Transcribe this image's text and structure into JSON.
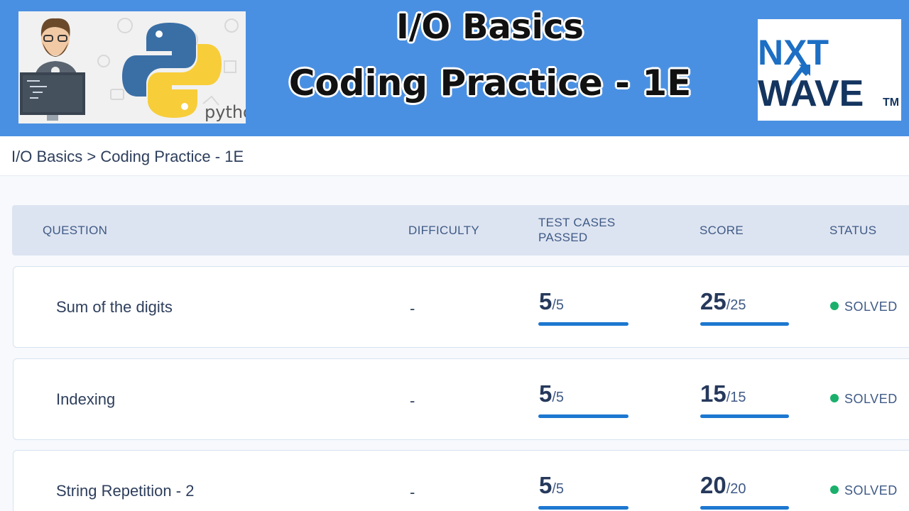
{
  "banner": {
    "title_line1": "I/O Basics",
    "title_line2": "Coding Practice - 1E",
    "thumbnail_text": "pytho",
    "logo_text_top": "NXT",
    "logo_text_bottom": "WAVE",
    "logo_tm": "TM",
    "bg_color": "#4a90e2"
  },
  "breadcrumb": {
    "parent": "I/O Basics",
    "separator": ">",
    "current": "Coding Practice - 1E"
  },
  "table": {
    "headers": {
      "question": "QUESTION",
      "difficulty": "DIFFICULTY",
      "test_cases_line1": "TEST CASES",
      "test_cases_line2": "PASSED",
      "score": "SCORE",
      "status": "STATUS"
    },
    "rows": [
      {
        "question": "Sum of the digits",
        "difficulty": "-",
        "passed": "5",
        "passed_total": "/5",
        "passed_fraction": 1.0,
        "score": "25",
        "score_total": "/25",
        "score_fraction": 1.0,
        "status": "SOLVED"
      },
      {
        "question": "Indexing",
        "difficulty": "-",
        "passed": "5",
        "passed_total": "/5",
        "passed_fraction": 1.0,
        "score": "15",
        "score_total": "/15",
        "score_fraction": 1.0,
        "status": "SOLVED"
      },
      {
        "question": "String Repetition - 2",
        "difficulty": "-",
        "passed": "5",
        "passed_total": "/5",
        "passed_fraction": 1.0,
        "score": "20",
        "score_total": "/20",
        "score_fraction": 1.0,
        "status": "SOLVED"
      }
    ]
  },
  "colors": {
    "progress": "#1d78d0",
    "solved": "#1ab06b"
  }
}
